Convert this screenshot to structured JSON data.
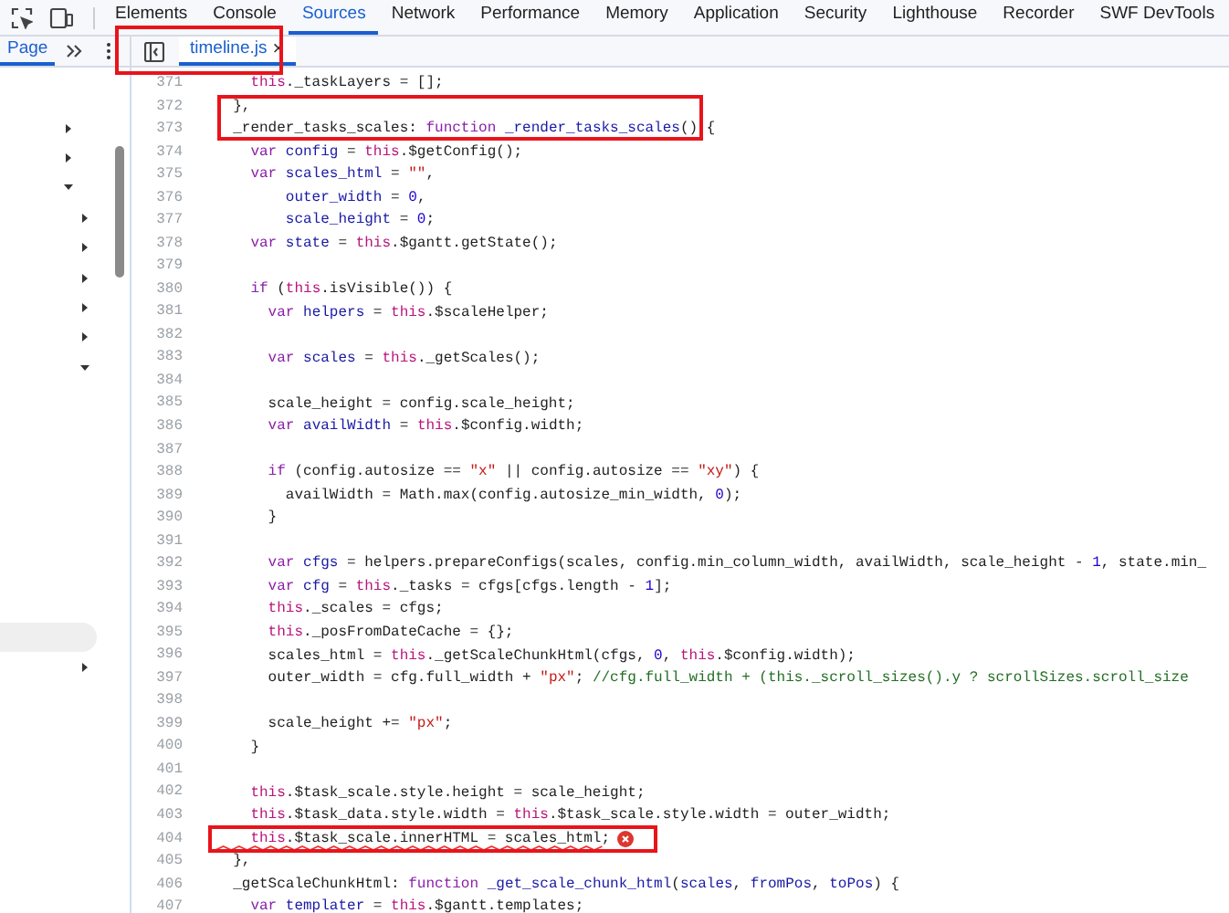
{
  "toolbar": {
    "tabs": [
      {
        "label": "Elements",
        "selected": false
      },
      {
        "label": "Console",
        "selected": false
      },
      {
        "label": "Sources",
        "selected": true
      },
      {
        "label": "Network",
        "selected": false
      },
      {
        "label": "Performance",
        "selected": false
      },
      {
        "label": "Memory",
        "selected": false
      },
      {
        "label": "Application",
        "selected": false
      },
      {
        "label": "Security",
        "selected": false
      },
      {
        "label": "Lighthouse",
        "selected": false
      },
      {
        "label": "Recorder",
        "selected": false
      },
      {
        "label": "SWF DevTools",
        "selected": false
      }
    ]
  },
  "navigator": {
    "tabs": [
      {
        "label": "Page",
        "selected": true
      }
    ],
    "tree": [
      {
        "kind": "folder",
        "expanded": false
      },
      {
        "kind": "folder",
        "expanded": false
      },
      {
        "kind": "folder",
        "expanded": true,
        "children": [
          {
            "kind": "folder",
            "expanded": false
          },
          {
            "kind": "folder",
            "expanded": false
          },
          {
            "kind": "folder",
            "expanded": false
          },
          {
            "kind": "folder",
            "expanded": false
          },
          {
            "kind": "folder",
            "expanded": false
          },
          {
            "kind": "folder",
            "expanded": true,
            "children": [
              {
                "kind": "file",
                "selected": true
              }
            ]
          },
          {
            "kind": "folder",
            "expanded": false
          }
        ]
      }
    ]
  },
  "editor": {
    "tabs": [
      {
        "label": "timeline.js",
        "close": "×",
        "selected": true
      }
    ],
    "lines": [
      {
        "number": "371",
        "error": false,
        "tokens": [
          {
            "kind": "t",
            "text": "    this"
          },
          {
            "kind": "p",
            "text": "._taskLayers = [];"
          }
        ]
      },
      {
        "number": "372",
        "error": false,
        "tokens": [
          {
            "kind": "p",
            "text": "  },"
          }
        ]
      },
      {
        "number": "373",
        "error": false,
        "tokens": [
          {
            "kind": "p",
            "text": "  _render_tasks_scales: "
          },
          {
            "kind": "k",
            "text": "function "
          },
          {
            "kind": "d",
            "text": "_render_tasks_scales"
          },
          {
            "kind": "p",
            "text": "() {"
          }
        ]
      },
      {
        "number": "374",
        "error": false,
        "tokens": [
          {
            "kind": "k",
            "text": "    var "
          },
          {
            "kind": "d",
            "text": "config"
          },
          {
            "kind": "p",
            "text": " = "
          },
          {
            "kind": "t",
            "text": "this"
          },
          {
            "kind": "p",
            "text": ".$getConfig();"
          }
        ]
      },
      {
        "number": "375",
        "error": false,
        "tokens": [
          {
            "kind": "k",
            "text": "    var "
          },
          {
            "kind": "d",
            "text": "scales_html"
          },
          {
            "kind": "p",
            "text": " = "
          },
          {
            "kind": "s",
            "text": "\"\""
          },
          {
            "kind": "p",
            "text": ","
          }
        ]
      },
      {
        "number": "376",
        "error": false,
        "tokens": [
          {
            "kind": "d",
            "text": "        outer_width"
          },
          {
            "kind": "p",
            "text": " = "
          },
          {
            "kind": "n",
            "text": "0"
          },
          {
            "kind": "p",
            "text": ","
          }
        ]
      },
      {
        "number": "377",
        "error": false,
        "tokens": [
          {
            "kind": "d",
            "text": "        scale_height"
          },
          {
            "kind": "p",
            "text": " = "
          },
          {
            "kind": "n",
            "text": "0"
          },
          {
            "kind": "p",
            "text": ";"
          }
        ]
      },
      {
        "number": "378",
        "error": false,
        "tokens": [
          {
            "kind": "k",
            "text": "    var "
          },
          {
            "kind": "d",
            "text": "state"
          },
          {
            "kind": "p",
            "text": " = "
          },
          {
            "kind": "t",
            "text": "this"
          },
          {
            "kind": "p",
            "text": ".$gantt.getState();"
          }
        ]
      },
      {
        "number": "379",
        "error": false
      },
      {
        "number": "380",
        "error": false,
        "tokens": [
          {
            "kind": "k",
            "text": "    if"
          },
          {
            "kind": "p",
            "text": " ("
          },
          {
            "kind": "t",
            "text": "this"
          },
          {
            "kind": "p",
            "text": ".isVisible()) {"
          }
        ]
      },
      {
        "number": "381",
        "error": false,
        "tokens": [
          {
            "kind": "k",
            "text": "      var "
          },
          {
            "kind": "d",
            "text": "helpers"
          },
          {
            "kind": "p",
            "text": " = "
          },
          {
            "kind": "t",
            "text": "this"
          },
          {
            "kind": "p",
            "text": ".$scaleHelper;"
          }
        ]
      },
      {
        "number": "382",
        "error": false
      },
      {
        "number": "383",
        "error": false,
        "tokens": [
          {
            "kind": "k",
            "text": "      var "
          },
          {
            "kind": "d",
            "text": "scales"
          },
          {
            "kind": "p",
            "text": " = "
          },
          {
            "kind": "t",
            "text": "this"
          },
          {
            "kind": "p",
            "text": "._getScales();"
          }
        ]
      },
      {
        "number": "384",
        "error": false
      },
      {
        "number": "385",
        "error": false,
        "tokens": [
          {
            "kind": "p",
            "text": "      scale_height = config.scale_height;"
          }
        ]
      },
      {
        "number": "386",
        "error": false,
        "tokens": [
          {
            "kind": "k",
            "text": "      var "
          },
          {
            "kind": "d",
            "text": "availWidth"
          },
          {
            "kind": "p",
            "text": " = "
          },
          {
            "kind": "t",
            "text": "this"
          },
          {
            "kind": "p",
            "text": ".$config.width;"
          }
        ]
      },
      {
        "number": "387",
        "error": false
      },
      {
        "number": "388",
        "error": false,
        "tokens": [
          {
            "kind": "k",
            "text": "      if"
          },
          {
            "kind": "p",
            "text": " (config.autosize == "
          },
          {
            "kind": "s",
            "text": "\"x\""
          },
          {
            "kind": "p",
            "text": " || config.autosize == "
          },
          {
            "kind": "s",
            "text": "\"xy\""
          },
          {
            "kind": "p",
            "text": ") {"
          }
        ]
      },
      {
        "number": "389",
        "error": false,
        "tokens": [
          {
            "kind": "p",
            "text": "        availWidth = Math.max(config.autosize_min_width, "
          },
          {
            "kind": "n",
            "text": "0"
          },
          {
            "kind": "p",
            "text": ");"
          }
        ]
      },
      {
        "number": "390",
        "error": false,
        "tokens": [
          {
            "kind": "p",
            "text": "      }"
          }
        ]
      },
      {
        "number": "391",
        "error": false
      },
      {
        "number": "392",
        "error": false,
        "tokens": [
          {
            "kind": "k",
            "text": "      var "
          },
          {
            "kind": "d",
            "text": "cfgs"
          },
          {
            "kind": "p",
            "text": " = helpers.prepareConfigs(scales, config.min_column_width, availWidth, scale_height - "
          },
          {
            "kind": "n",
            "text": "1"
          },
          {
            "kind": "p",
            "text": ", state.min_"
          }
        ]
      },
      {
        "number": "393",
        "error": false,
        "tokens": [
          {
            "kind": "k",
            "text": "      var "
          },
          {
            "kind": "d",
            "text": "cfg"
          },
          {
            "kind": "p",
            "text": " = "
          },
          {
            "kind": "t",
            "text": "this"
          },
          {
            "kind": "p",
            "text": "._tasks = cfgs[cfgs.length - "
          },
          {
            "kind": "n",
            "text": "1"
          },
          {
            "kind": "p",
            "text": "];"
          }
        ]
      },
      {
        "number": "394",
        "error": false,
        "tokens": [
          {
            "kind": "t",
            "text": "      this"
          },
          {
            "kind": "p",
            "text": "._scales = cfgs;"
          }
        ]
      },
      {
        "number": "395",
        "error": false,
        "tokens": [
          {
            "kind": "t",
            "text": "      this"
          },
          {
            "kind": "p",
            "text": "._posFromDateCache = {};"
          }
        ]
      },
      {
        "number": "396",
        "error": false,
        "tokens": [
          {
            "kind": "p",
            "text": "      scales_html = "
          },
          {
            "kind": "t",
            "text": "this"
          },
          {
            "kind": "p",
            "text": "._getScaleChunkHtml(cfgs, "
          },
          {
            "kind": "n",
            "text": "0"
          },
          {
            "kind": "p",
            "text": ", "
          },
          {
            "kind": "t",
            "text": "this"
          },
          {
            "kind": "p",
            "text": ".$config.width);"
          }
        ]
      },
      {
        "number": "397",
        "error": false,
        "tokens": [
          {
            "kind": "p",
            "text": "      outer_width = cfg.full_width + "
          },
          {
            "kind": "s",
            "text": "\"px\""
          },
          {
            "kind": "p",
            "text": "; "
          },
          {
            "kind": "c",
            "text": "//cfg.full_width + (this._scroll_sizes().y ? scrollSizes.scroll_size"
          }
        ]
      },
      {
        "number": "398",
        "error": false
      },
      {
        "number": "399",
        "error": false,
        "tokens": [
          {
            "kind": "p",
            "text": "      scale_height += "
          },
          {
            "kind": "s",
            "text": "\"px\""
          },
          {
            "kind": "p",
            "text": ";"
          }
        ]
      },
      {
        "number": "400",
        "error": false,
        "tokens": [
          {
            "kind": "p",
            "text": "    }"
          }
        ]
      },
      {
        "number": "401",
        "error": false
      },
      {
        "number": "402",
        "error": false,
        "tokens": [
          {
            "kind": "t",
            "text": "    this"
          },
          {
            "kind": "p",
            "text": ".$task_scale.style.height = scale_height;"
          }
        ]
      },
      {
        "number": "403",
        "error": false,
        "tokens": [
          {
            "kind": "t",
            "text": "    this"
          },
          {
            "kind": "p",
            "text": ".$task_data.style.width = "
          },
          {
            "kind": "t",
            "text": "this"
          },
          {
            "kind": "p",
            "text": ".$task_scale.style.width = outer_width;"
          }
        ]
      },
      {
        "number": "404",
        "error": true,
        "tokens": [
          {
            "kind": "t",
            "text": "    this"
          },
          {
            "kind": "p",
            "text": ".$task_scale.innerHTML = scales_html;"
          }
        ]
      },
      {
        "number": "405",
        "error": false,
        "tokens": [
          {
            "kind": "p",
            "text": "  },"
          }
        ]
      },
      {
        "number": "406",
        "error": false,
        "tokens": [
          {
            "kind": "p",
            "text": "  _getScaleChunkHtml: "
          },
          {
            "kind": "k",
            "text": "function "
          },
          {
            "kind": "d",
            "text": "_get_scale_chunk_html"
          },
          {
            "kind": "p",
            "text": "("
          },
          {
            "kind": "d",
            "text": "scales"
          },
          {
            "kind": "p",
            "text": ", "
          },
          {
            "kind": "d",
            "text": "fromPos"
          },
          {
            "kind": "p",
            "text": ", "
          },
          {
            "kind": "d",
            "text": "toPos"
          },
          {
            "kind": "p",
            "text": ") {"
          }
        ]
      },
      {
        "number": "407",
        "error": false,
        "tokens": [
          {
            "kind": "k",
            "text": "    var "
          },
          {
            "kind": "d",
            "text": "templater"
          },
          {
            "kind": "p",
            "text": " = "
          },
          {
            "kind": "t",
            "text": "this"
          },
          {
            "kind": "p",
            "text": ".$gantt.templates;"
          }
        ]
      }
    ]
  }
}
